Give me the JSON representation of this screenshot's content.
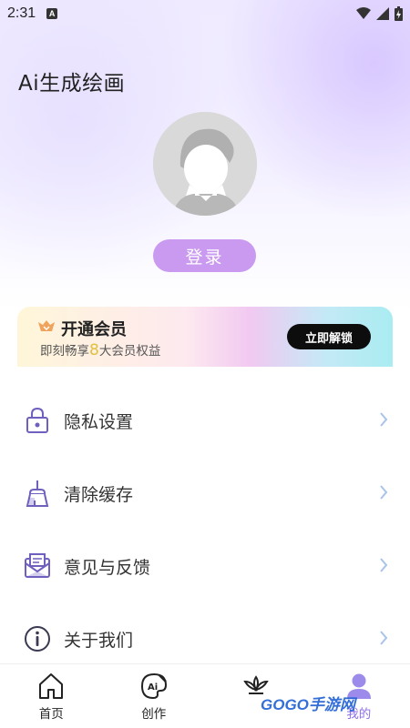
{
  "status_bar": {
    "time": "2:31",
    "badge": "A"
  },
  "app_title": "Ai生成绘画",
  "login_label": "登录",
  "vip": {
    "title": "开通会员",
    "subtitle_prefix": "即刻畅享",
    "subtitle_number": "8",
    "subtitle_suffix": "大会员权益",
    "button_label": "立即解锁"
  },
  "menu": [
    {
      "label": "隐私设置",
      "icon": "lock-icon"
    },
    {
      "label": "清除缓存",
      "icon": "broom-icon"
    },
    {
      "label": "意见与反馈",
      "icon": "mail-icon"
    },
    {
      "label": "关于我们",
      "icon": "info-icon"
    }
  ],
  "tabs": [
    {
      "label": "首页",
      "icon": "home-icon"
    },
    {
      "label": "创作",
      "icon": "palette-icon"
    },
    {
      "label": "",
      "icon": "lotus-icon"
    },
    {
      "label": "我的",
      "icon": "user-icon"
    }
  ],
  "watermark": "GOGO手游网",
  "colors": {
    "accent": "#8c6ee8",
    "login": "#c99af0",
    "vip_button": "#0d0d0d"
  }
}
